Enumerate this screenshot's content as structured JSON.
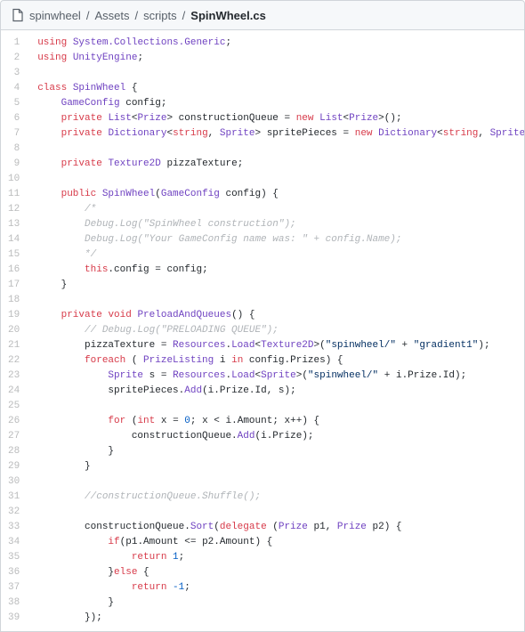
{
  "breadcrumb": {
    "segments": [
      "spinwheel",
      "Assets",
      "scripts",
      "SpinWheel.cs"
    ]
  },
  "code": {
    "lines": [
      [
        [
          "k",
          "using"
        ],
        [
          "p",
          " "
        ],
        [
          "t",
          "System.Collections.Generic"
        ],
        [
          "p",
          ";"
        ]
      ],
      [
        [
          "k",
          "using"
        ],
        [
          "p",
          " "
        ],
        [
          "t",
          "UnityEngine"
        ],
        [
          "p",
          ";"
        ]
      ],
      [],
      [
        [
          "k",
          "class"
        ],
        [
          "p",
          " "
        ],
        [
          "t",
          "SpinWheel"
        ],
        [
          "p",
          " {"
        ]
      ],
      [
        [
          "p",
          "    "
        ],
        [
          "t",
          "GameConfig"
        ],
        [
          "p",
          " "
        ],
        [
          "v",
          "config"
        ],
        [
          "p",
          ";"
        ]
      ],
      [
        [
          "p",
          "    "
        ],
        [
          "k",
          "private"
        ],
        [
          "p",
          " "
        ],
        [
          "t",
          "List"
        ],
        [
          "p",
          "<"
        ],
        [
          "t",
          "Prize"
        ],
        [
          "p",
          "> "
        ],
        [
          "v",
          "constructionQueue"
        ],
        [
          "p",
          " = "
        ],
        [
          "k",
          "new"
        ],
        [
          "p",
          " "
        ],
        [
          "t",
          "List"
        ],
        [
          "p",
          "<"
        ],
        [
          "t",
          "Prize"
        ],
        [
          "p",
          ">();"
        ]
      ],
      [
        [
          "p",
          "    "
        ],
        [
          "k",
          "private"
        ],
        [
          "p",
          " "
        ],
        [
          "t",
          "Dictionary"
        ],
        [
          "p",
          "<"
        ],
        [
          "k",
          "string"
        ],
        [
          "p",
          ", "
        ],
        [
          "t",
          "Sprite"
        ],
        [
          "p",
          "> "
        ],
        [
          "v",
          "spritePieces"
        ],
        [
          "p",
          " = "
        ],
        [
          "k",
          "new"
        ],
        [
          "p",
          " "
        ],
        [
          "t",
          "Dictionary"
        ],
        [
          "p",
          "<"
        ],
        [
          "k",
          "string"
        ],
        [
          "p",
          ", "
        ],
        [
          "t",
          "Sprite"
        ],
        [
          "p",
          ">();"
        ]
      ],
      [],
      [
        [
          "p",
          "    "
        ],
        [
          "k",
          "private"
        ],
        [
          "p",
          " "
        ],
        [
          "t",
          "Texture2D"
        ],
        [
          "p",
          " "
        ],
        [
          "v",
          "pizzaTexture"
        ],
        [
          "p",
          ";"
        ]
      ],
      [],
      [
        [
          "p",
          "    "
        ],
        [
          "k",
          "public"
        ],
        [
          "p",
          " "
        ],
        [
          "t",
          "SpinWheel"
        ],
        [
          "p",
          "("
        ],
        [
          "t",
          "GameConfig"
        ],
        [
          "p",
          " "
        ],
        [
          "v",
          "config"
        ],
        [
          "p",
          ") {"
        ]
      ],
      [
        [
          "p",
          "        "
        ],
        [
          "c",
          "/*"
        ]
      ],
      [
        [
          "p",
          "        "
        ],
        [
          "c",
          "Debug.Log(\"SpinWheel construction\");"
        ]
      ],
      [
        [
          "p",
          "        "
        ],
        [
          "c",
          "Debug.Log(\"Your GameConfig name was: \" + config.Name);"
        ]
      ],
      [
        [
          "p",
          "        "
        ],
        [
          "c",
          "*/"
        ]
      ],
      [
        [
          "p",
          "        "
        ],
        [
          "k",
          "this"
        ],
        [
          "p",
          "."
        ],
        [
          "v",
          "config"
        ],
        [
          "p",
          " = "
        ],
        [
          "v",
          "config"
        ],
        [
          "p",
          ";"
        ]
      ],
      [
        [
          "p",
          "    }"
        ]
      ],
      [],
      [
        [
          "p",
          "    "
        ],
        [
          "k",
          "private"
        ],
        [
          "p",
          " "
        ],
        [
          "k",
          "void"
        ],
        [
          "p",
          " "
        ],
        [
          "t",
          "PreloadAndQueues"
        ],
        [
          "p",
          "() {"
        ]
      ],
      [
        [
          "p",
          "        "
        ],
        [
          "c",
          "// Debug.Log(\"PRELOADING QUEUE\");"
        ]
      ],
      [
        [
          "p",
          "        "
        ],
        [
          "v",
          "pizzaTexture"
        ],
        [
          "p",
          " = "
        ],
        [
          "t",
          "Resources"
        ],
        [
          "p",
          "."
        ],
        [
          "t",
          "Load"
        ],
        [
          "p",
          "<"
        ],
        [
          "t",
          "Texture2D"
        ],
        [
          "p",
          ">("
        ],
        [
          "s",
          "\"spinwheel/\""
        ],
        [
          "p",
          " + "
        ],
        [
          "s",
          "\"gradient1\""
        ],
        [
          "p",
          ");"
        ]
      ],
      [
        [
          "p",
          "        "
        ],
        [
          "k",
          "foreach"
        ],
        [
          "p",
          " ( "
        ],
        [
          "t",
          "PrizeListing"
        ],
        [
          "p",
          " "
        ],
        [
          "v",
          "i"
        ],
        [
          "p",
          " "
        ],
        [
          "k",
          "in"
        ],
        [
          "p",
          " "
        ],
        [
          "v",
          "config"
        ],
        [
          "p",
          "."
        ],
        [
          "v",
          "Prizes"
        ],
        [
          "p",
          ") {"
        ]
      ],
      [
        [
          "p",
          "            "
        ],
        [
          "t",
          "Sprite"
        ],
        [
          "p",
          " "
        ],
        [
          "v",
          "s"
        ],
        [
          "p",
          " = "
        ],
        [
          "t",
          "Resources"
        ],
        [
          "p",
          "."
        ],
        [
          "t",
          "Load"
        ],
        [
          "p",
          "<"
        ],
        [
          "t",
          "Sprite"
        ],
        [
          "p",
          ">("
        ],
        [
          "s",
          "\"spinwheel/\""
        ],
        [
          "p",
          " + "
        ],
        [
          "v",
          "i"
        ],
        [
          "p",
          "."
        ],
        [
          "v",
          "Prize"
        ],
        [
          "p",
          "."
        ],
        [
          "v",
          "Id"
        ],
        [
          "p",
          ");"
        ]
      ],
      [
        [
          "p",
          "            "
        ],
        [
          "v",
          "spritePieces"
        ],
        [
          "p",
          "."
        ],
        [
          "t",
          "Add"
        ],
        [
          "p",
          "("
        ],
        [
          "v",
          "i"
        ],
        [
          "p",
          "."
        ],
        [
          "v",
          "Prize"
        ],
        [
          "p",
          "."
        ],
        [
          "v",
          "Id"
        ],
        [
          "p",
          ", "
        ],
        [
          "v",
          "s"
        ],
        [
          "p",
          ");"
        ]
      ],
      [],
      [
        [
          "p",
          "            "
        ],
        [
          "k",
          "for"
        ],
        [
          "p",
          " ("
        ],
        [
          "k",
          "int"
        ],
        [
          "p",
          " "
        ],
        [
          "v",
          "x"
        ],
        [
          "p",
          " = "
        ],
        [
          "n",
          "0"
        ],
        [
          "p",
          "; "
        ],
        [
          "v",
          "x"
        ],
        [
          "p",
          " < "
        ],
        [
          "v",
          "i"
        ],
        [
          "p",
          "."
        ],
        [
          "v",
          "Amount"
        ],
        [
          "p",
          "; "
        ],
        [
          "v",
          "x"
        ],
        [
          "p",
          "++) {"
        ]
      ],
      [
        [
          "p",
          "                "
        ],
        [
          "v",
          "constructionQueue"
        ],
        [
          "p",
          "."
        ],
        [
          "t",
          "Add"
        ],
        [
          "p",
          "("
        ],
        [
          "v",
          "i"
        ],
        [
          "p",
          "."
        ],
        [
          "v",
          "Prize"
        ],
        [
          "p",
          ");"
        ]
      ],
      [
        [
          "p",
          "            }"
        ]
      ],
      [
        [
          "p",
          "        }"
        ]
      ],
      [],
      [
        [
          "p",
          "        "
        ],
        [
          "c",
          "//constructionQueue.Shuffle();"
        ]
      ],
      [],
      [
        [
          "p",
          "        "
        ],
        [
          "v",
          "constructionQueue"
        ],
        [
          "p",
          "."
        ],
        [
          "t",
          "Sort"
        ],
        [
          "p",
          "("
        ],
        [
          "k",
          "delegate"
        ],
        [
          "p",
          " ("
        ],
        [
          "t",
          "Prize"
        ],
        [
          "p",
          " "
        ],
        [
          "v",
          "p1"
        ],
        [
          "p",
          ", "
        ],
        [
          "t",
          "Prize"
        ],
        [
          "p",
          " "
        ],
        [
          "v",
          "p2"
        ],
        [
          "p",
          ") {"
        ]
      ],
      [
        [
          "p",
          "            "
        ],
        [
          "k",
          "if"
        ],
        [
          "p",
          "("
        ],
        [
          "v",
          "p1"
        ],
        [
          "p",
          "."
        ],
        [
          "v",
          "Amount"
        ],
        [
          "p",
          " <= "
        ],
        [
          "v",
          "p2"
        ],
        [
          "p",
          "."
        ],
        [
          "v",
          "Amount"
        ],
        [
          "p",
          ") {"
        ]
      ],
      [
        [
          "p",
          "                "
        ],
        [
          "k",
          "return"
        ],
        [
          "p",
          " "
        ],
        [
          "n",
          "1"
        ],
        [
          "p",
          ";"
        ]
      ],
      [
        [
          "p",
          "            }"
        ],
        [
          "k",
          "else"
        ],
        [
          "p",
          " {"
        ]
      ],
      [
        [
          "p",
          "                "
        ],
        [
          "k",
          "return"
        ],
        [
          "p",
          " "
        ],
        [
          "n",
          "-1"
        ],
        [
          "p",
          ";"
        ]
      ],
      [
        [
          "p",
          "            }"
        ]
      ],
      [
        [
          "p",
          "        });"
        ]
      ]
    ]
  }
}
